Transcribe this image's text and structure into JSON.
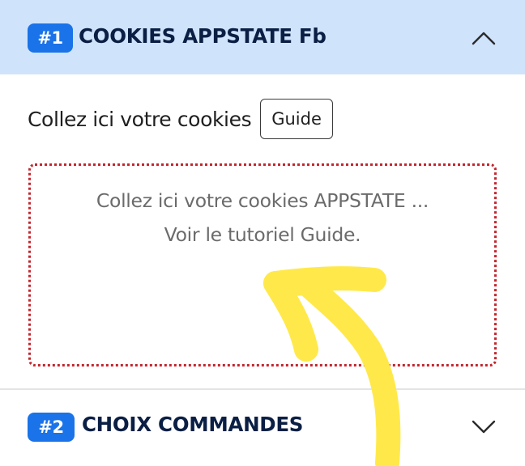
{
  "section1": {
    "badge": "#1",
    "title": "COOKIES APPSTATE Fb",
    "chevron_icon": "chevron-up-icon",
    "field_label": "Collez ici votre cookies",
    "guide_button_label": "Guide",
    "textarea": {
      "placeholder_line1": "Collez ici votre cookies APPSTATE ...",
      "placeholder_line2": "Voir le tutoriel Guide.",
      "value": ""
    }
  },
  "section2": {
    "badge": "#2",
    "title": "CHOIX COMMANDES",
    "chevron_icon": "chevron-down-icon"
  },
  "annotation": {
    "icon": "hand-drawn-arrow-icon",
    "color": "#ffe94a"
  },
  "colors": {
    "header_active_bg": "#cfe3fb",
    "badge_bg": "#1a73e8",
    "title_text": "#0b1f44",
    "textarea_border": "#c4262e"
  }
}
